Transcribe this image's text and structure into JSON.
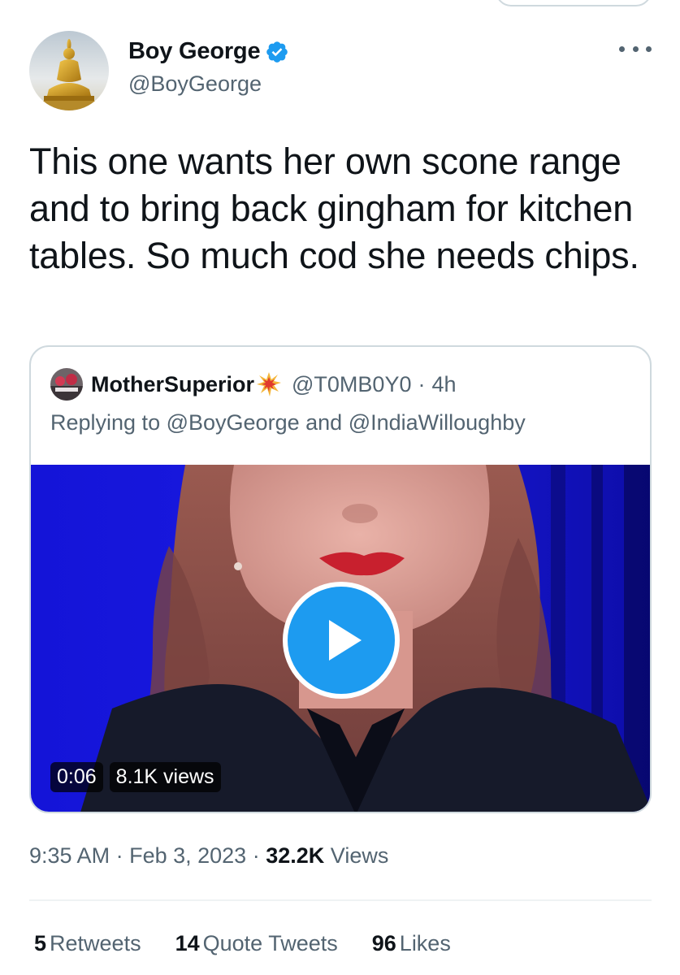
{
  "tweet": {
    "display_name": "Boy George",
    "handle": "@BoyGeorge",
    "verified": true,
    "text": "This one wants her own scone range and to bring back gingham for kitchen tables. So much cod she needs chips.",
    "time": "9:35 AM",
    "date": "Feb 3, 2023",
    "views_count": "32.2K",
    "views_label": "Views"
  },
  "quote": {
    "display_name": "MotherSuperior",
    "handle": "@T0MB0Y0",
    "time": "4h",
    "replying_prefix": "Replying to",
    "reply_to_1": "@BoyGeorge",
    "reply_conj": "and",
    "reply_to_2": "@IndiaWilloughby",
    "video": {
      "duration": "0:06",
      "views": "8.1K views"
    }
  },
  "stats": {
    "retweets_count": "5",
    "retweets_label": "Retweets",
    "quotes_count": "14",
    "quotes_label": "Quote Tweets",
    "likes_count": "96",
    "likes_label": "Likes"
  },
  "colors": {
    "accent": "#1d9bf0",
    "text_primary": "#0f1419",
    "text_secondary": "#536471",
    "border": "#cfd9de"
  },
  "icons": {
    "verified": "verified-badge-icon",
    "more": "more-horizontal-icon",
    "play": "play-icon",
    "quote_emoji": "collision-emoji-icon"
  }
}
